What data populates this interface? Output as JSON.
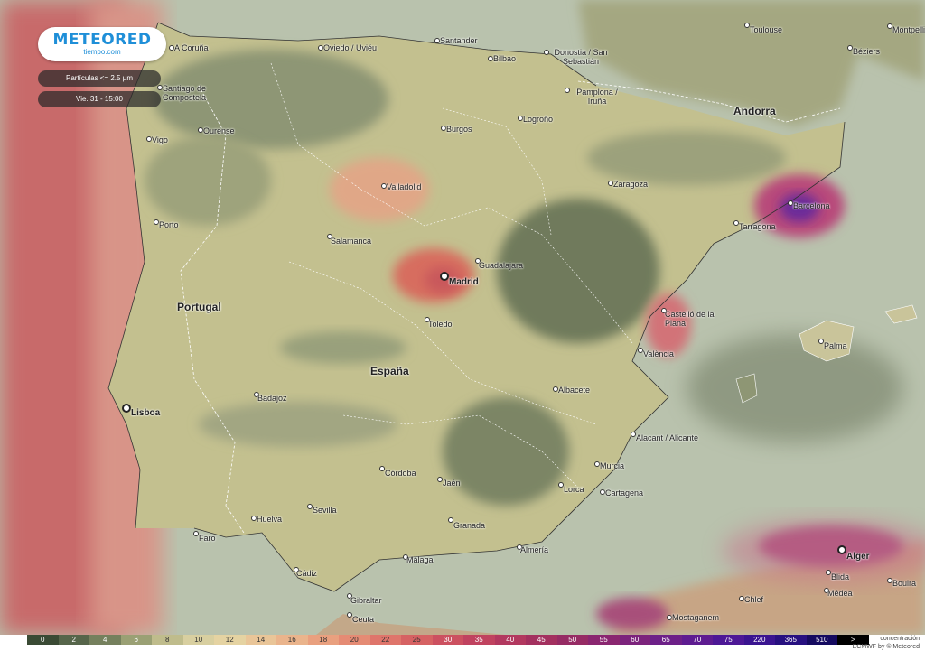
{
  "logo": {
    "name": "METEORED",
    "sub": "tiempo.com"
  },
  "controls": {
    "variable": "Partículas <= 2.5 µm",
    "time": "Vie. 31 - 15:00"
  },
  "countries": [
    {
      "name": "Portugal"
    },
    {
      "name": "España"
    },
    {
      "name": "Andorra"
    }
  ],
  "capitals": [
    {
      "name": "Madrid"
    },
    {
      "name": "Lisboa"
    },
    {
      "name": "Alger"
    }
  ],
  "cities": [
    "A Coruña",
    "Oviedo / Uviéu",
    "Santander",
    "Bilbao",
    "Donostia / San Sebastián",
    "Toulouse",
    "Montpellier",
    "Béziers",
    "Santiago de Compostela",
    "Ourense",
    "Vigo",
    "Burgos",
    "Logroño",
    "Pamplona / Iruña",
    "Zaragoza",
    "Barcelona",
    "Tarragona",
    "Valladolid",
    "Porto",
    "Salamanca",
    "Guadalajara",
    "Toledo",
    "Castelló de la Plana",
    "València",
    "Palma",
    "Badajoz",
    "Albacete",
    "Alacant / Alicante",
    "Murcia",
    "Córdoba",
    "Jaén",
    "Lorca",
    "Cartagena",
    "Sevilla",
    "Huelva",
    "Granada",
    "Faro",
    "Almería",
    "Cádiz",
    "Málaga",
    "Gibraltar",
    "Ceuta",
    "Blida",
    "Médéa",
    "Bouira",
    "Chlef",
    "Mostaganem"
  ],
  "legend": {
    "title": "concentración",
    "credit": "ECMWF by © Meteored",
    "values": [
      "0",
      "2",
      "4",
      "6",
      "8",
      "10",
      "12",
      "14",
      "16",
      "18",
      "20",
      "22",
      "25",
      "30",
      "35",
      "40",
      "45",
      "50",
      "55",
      "60",
      "65",
      "70",
      "75",
      "220",
      "365",
      "510",
      ">"
    ],
    "colors": [
      "#3a4a34",
      "#56654a",
      "#75805d",
      "#9aa074",
      "#bfbc8c",
      "#d8cfa0",
      "#e5d3a2",
      "#e9c598",
      "#eab48c",
      "#e9a07f",
      "#e58b74",
      "#df756b",
      "#d66263",
      "#cc5060",
      "#c0425f",
      "#b2385f",
      "#a3305f",
      "#962b64",
      "#8a2670",
      "#7c237c",
      "#6d2088",
      "#5e1c91",
      "#4d1896",
      "#3a1490",
      "#271080",
      "#150a60",
      "#000000"
    ]
  }
}
